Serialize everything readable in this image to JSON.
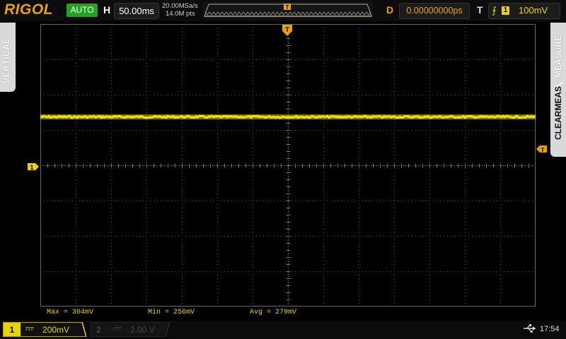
{
  "header": {
    "brand": "RIGOL",
    "mode": "AUTO",
    "horizontal_label": "H",
    "timebase": "50.00ms",
    "sample_rate": "20.00MSa/s",
    "memory_depth": "14.0M pts",
    "delay_label": "D",
    "delay": "0.00000000ps",
    "trigger_label": "T",
    "trigger_channel": "1",
    "trigger_level": "100mV"
  },
  "side": {
    "left_tab": "VERTICAL",
    "right_tab_top": "MEASURE",
    "right_tab_bottom": "CLEARMEAS"
  },
  "markers": {
    "ch1_marker": "1",
    "trigger_marker": "T",
    "top_marker": "T"
  },
  "measurements": {
    "max": "Max = 304mV",
    "min": "Min = 256mV",
    "avg": "Avg = 279mV"
  },
  "footer": {
    "ch1_num": "1",
    "ch1_scale": "200mV",
    "ch2_num": "2",
    "ch2_scale": "2.00 V",
    "time": "17:54"
  },
  "colors": {
    "ch1": "#e8d400",
    "accent": "#e8a200",
    "auto": "#1fa51f"
  },
  "icons": {
    "usb": "usb-icon",
    "trigger_edge": "rising-edge-icon"
  }
}
